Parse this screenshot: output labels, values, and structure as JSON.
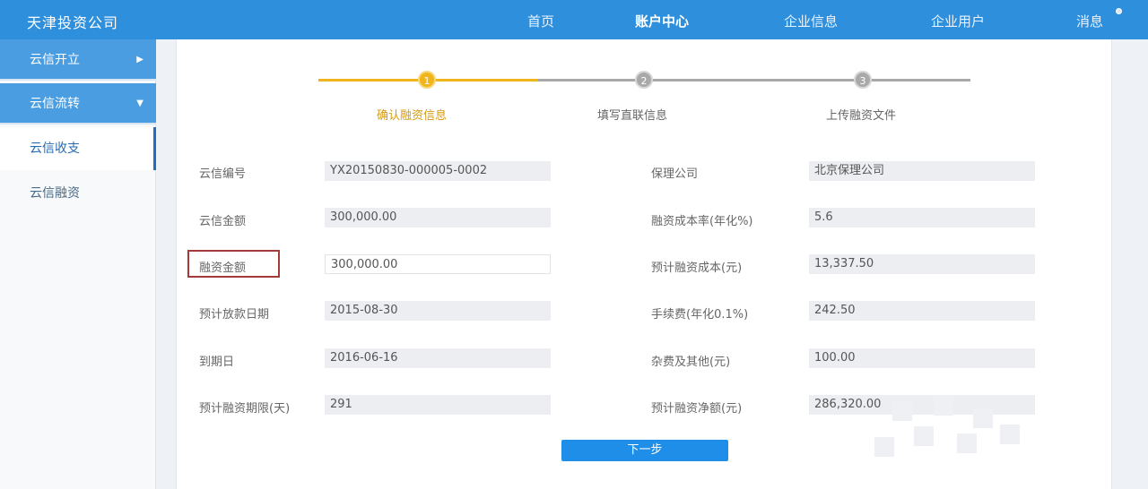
{
  "header": {
    "brand": "天津投资公司",
    "nav": [
      {
        "label": "首页",
        "active": false
      },
      {
        "label": "账户中心",
        "active": true
      },
      {
        "label": "企业信息",
        "active": false
      },
      {
        "label": "企业用户",
        "active": false
      },
      {
        "label": "消息",
        "active": false
      }
    ]
  },
  "sidebar": {
    "groups": [
      {
        "label": "云信开立",
        "arrow": "▶"
      },
      {
        "label": "云信流转",
        "arrow": "▼"
      }
    ],
    "items": [
      {
        "label": "云信收支",
        "active": true
      },
      {
        "label": "云信融资",
        "active": false
      }
    ]
  },
  "steps": [
    {
      "number": "1",
      "label": "确认融资信息",
      "active": true
    },
    {
      "number": "2",
      "label": "填写直联信息",
      "active": false
    },
    {
      "number": "3",
      "label": "上传融资文件",
      "active": false
    }
  ],
  "form": {
    "left": [
      {
        "label": "云信编号",
        "value": "YX20150830-000005-0002"
      },
      {
        "label": "云信金额",
        "value": "300,000.00"
      },
      {
        "label": "融资金额",
        "value": "300,000.00"
      },
      {
        "label": "预计放款日期",
        "value": "2015-08-30"
      },
      {
        "label": "到期日",
        "value": "2016-06-16"
      },
      {
        "label": "预计融资期限(天)",
        "value": "291"
      }
    ],
    "right": [
      {
        "label": "保理公司",
        "value": "北京保理公司"
      },
      {
        "label": "融资成本率(年化%)",
        "value": "5.6"
      },
      {
        "label": "预计融资成本(元)",
        "value": "13,337.50"
      },
      {
        "label": "手续费(年化0.1%)",
        "value": "242.50"
      },
      {
        "label": "杂费及其他(元)",
        "value": "100.00"
      },
      {
        "label": "预计融资净额(元)",
        "value": "286,320.00"
      }
    ]
  },
  "actions": {
    "next_label": "下一步"
  },
  "colors": {
    "header": "#2e8fdc",
    "sidebar_head": "#4a9de0",
    "step_active": "#f0b51a",
    "button": "#1f8ee8",
    "highlight_box": "#a43a3a"
  }
}
